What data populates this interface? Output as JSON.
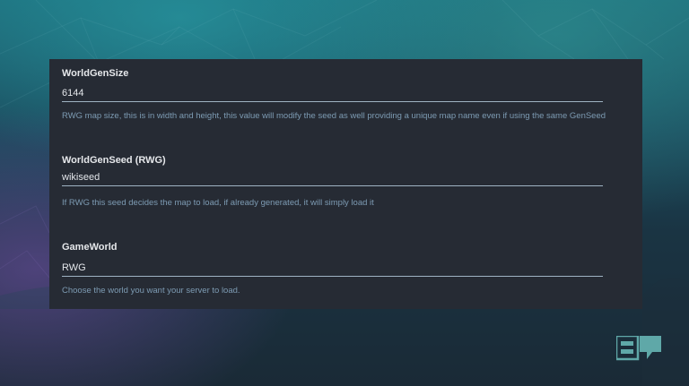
{
  "settings": [
    {
      "label": "WorldGenSize",
      "value": "6144",
      "help": "RWG map size, this is in width and height, this value will modify the seed as well providing a unique map name even if using the same GenSeed"
    },
    {
      "label": "WorldGenSeed (RWG)",
      "value": "wikiseed",
      "help": "If RWG this seed decides the map to load, if already generated, it will simply load it"
    },
    {
      "label": "GameWorld",
      "value": "RWG",
      "help": "Choose the world you want your server to load."
    }
  ],
  "colors": {
    "panel": "#262b34",
    "label": "#e6e8eb",
    "help": "#7d9bb3",
    "underline": "#9fb3c3",
    "logo": "#5fa8a8"
  },
  "icons": {
    "logo": "gameserver-logo-icon"
  }
}
